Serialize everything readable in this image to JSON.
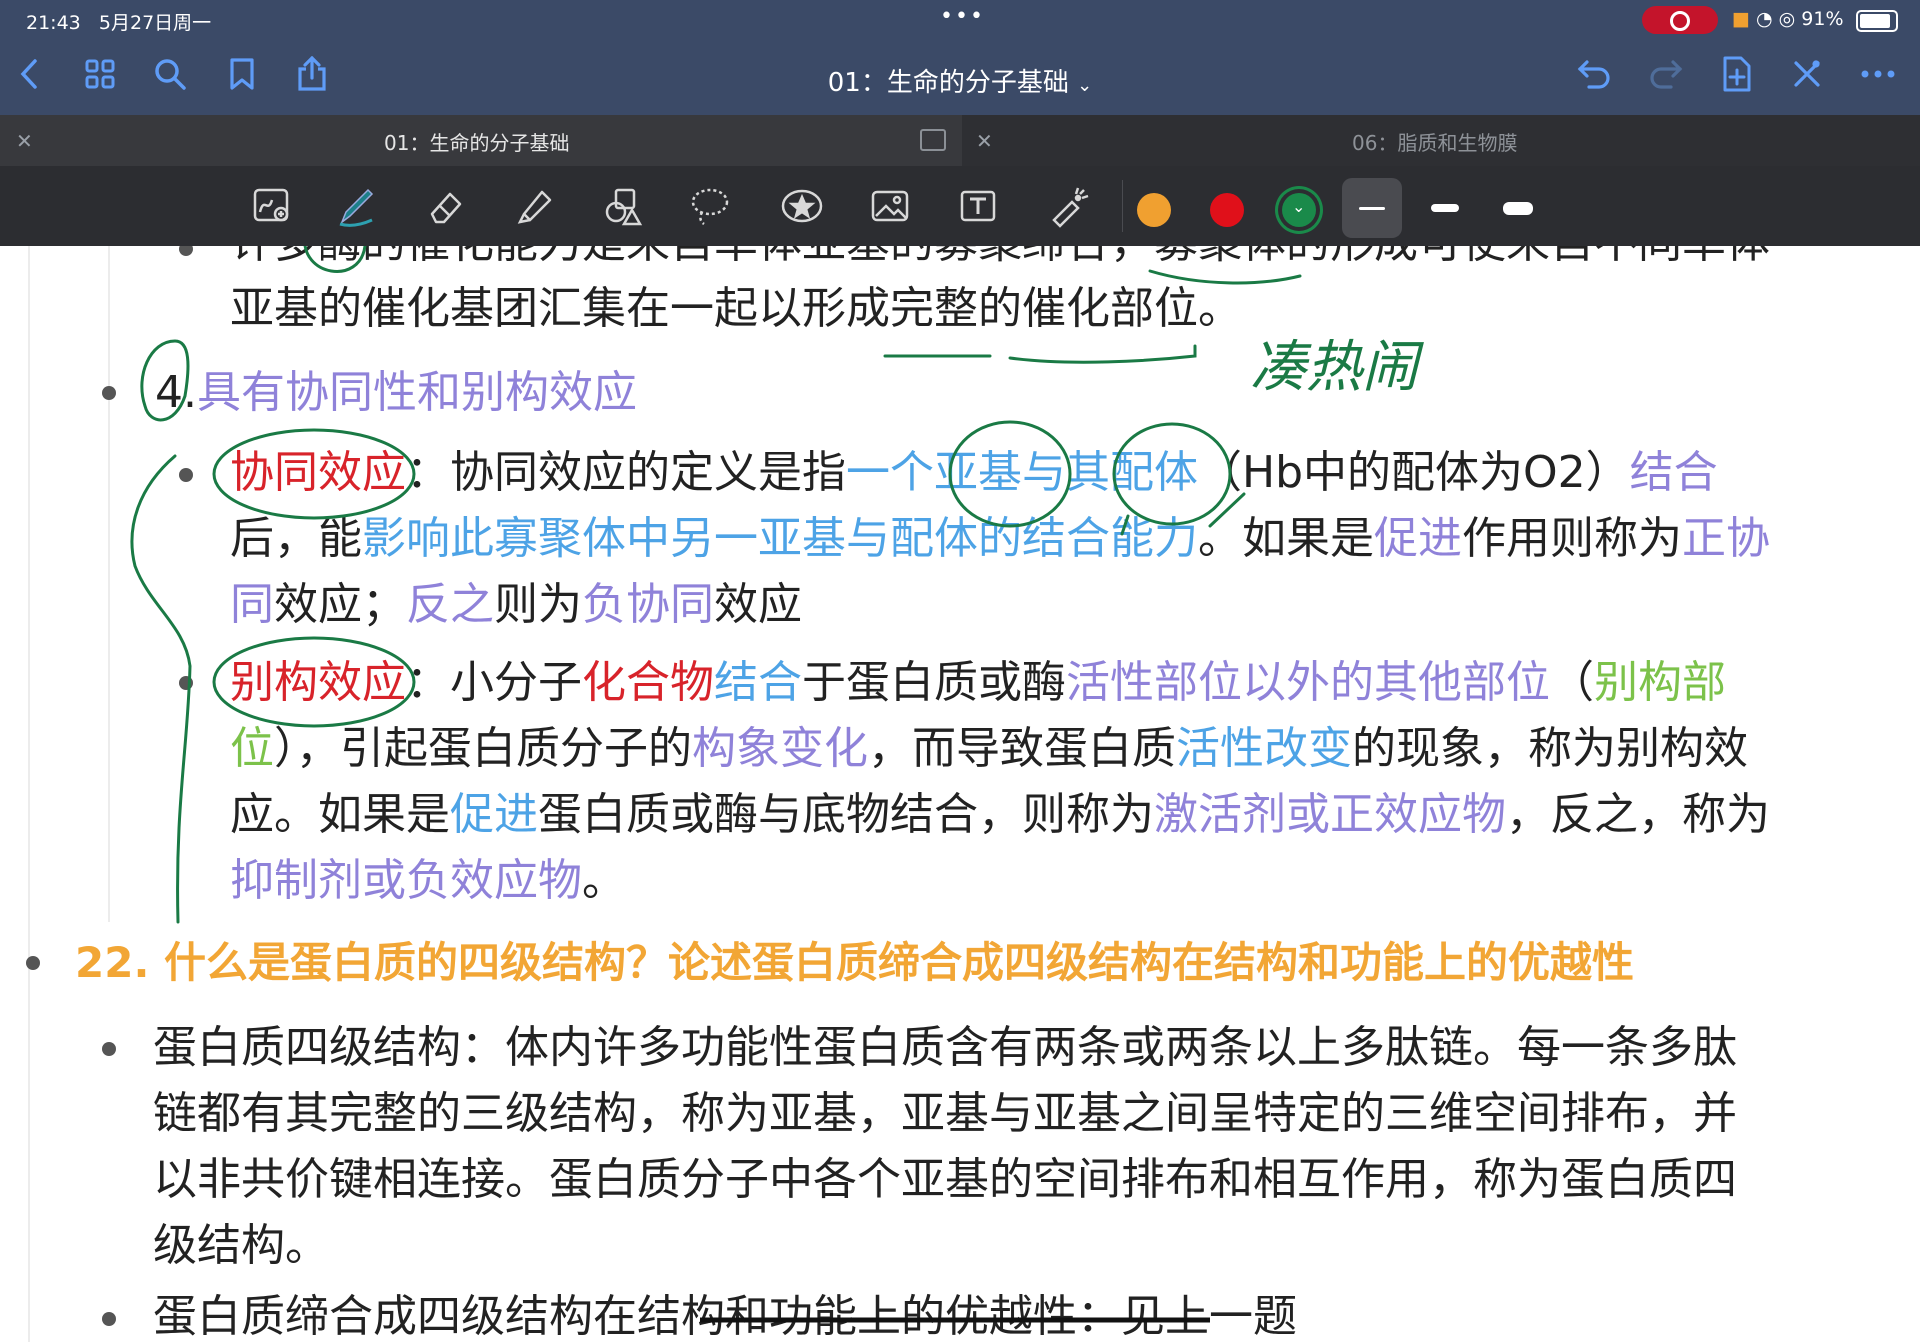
{
  "status_bar": {
    "time": "21:43",
    "date": "5月27日周一",
    "battery": "91%"
  },
  "nav": {
    "title": "01：生命的分子基础",
    "title_caret": "⌄"
  },
  "tabs": [
    {
      "label": "01：生命的分子基础"
    },
    {
      "label": "06：脂质和生物膜"
    }
  ],
  "toolbar": {
    "colors": [
      "#f0a030",
      "#e0101a",
      "#1a8a4a"
    ]
  },
  "content": {
    "line0_a": "许多酶的催化能力是来自单体亚基的募聚缔合，募聚体的形成可使来自不同单体",
    "line1": "亚基的催化基团汇集在一起以形成完整的催化部位。",
    "item4_num": "4.",
    "item4_text": "具有协同性和别构效应",
    "coop": {
      "term": "协同效应",
      "p1_a": "：协同效应的定义是指",
      "p1_b": "一个亚基与其配体",
      "p1_c": "（Hb中的配体为O2）",
      "p1_d": "结合",
      "p2_a": "后，能",
      "p2_b": "影响此寡聚体中另一亚基与配体的结合能力",
      "p2_c": "。如果是",
      "p2_d": "促进",
      "p2_e": "作用则称为",
      "p2_f": "正协",
      "p3_a": "同",
      "p3_b": "效应；",
      "p3_c": "反之",
      "p3_d": "则为",
      "p3_e": "负协同",
      "p3_f": "效应"
    },
    "allo": {
      "term": "别构效应",
      "p1_a": "：小分子",
      "p1_b": "化合物",
      "p1_c": "结合",
      "p1_d": "于蛋白质或酶",
      "p1_e": "活性部位以外的其他部位",
      "p1_f": "（",
      "p1_g": "别构部",
      "p2_a": "位",
      "p2_b": "），引起蛋白质分子的",
      "p2_c": "构象变化",
      "p2_d": "，而导致蛋白质",
      "p2_e": "活性改变",
      "p2_f": "的现象，称为别构效",
      "p3_a": "应。如果是",
      "p3_b": "促进",
      "p3_c": "蛋白质或酶与底物结合，则称为",
      "p3_d": "激活剂或正效应物",
      "p3_e": "，反之，称为",
      "p4_a": "抑制剂或负效应物",
      "p4_b": "。"
    },
    "q22": "22. 什么是蛋白质的四级结构？论述蛋白质缔合成四级结构在结构和功能上的优越性",
    "q22_a1": "蛋白质四级结构：体内许多功能性蛋白质含有两条或两条以上多肽链。每一条多肽",
    "q22_a2": "链都有其完整的三级结构，称为亚基，亚基与亚基之间呈特定的三维空间排布，并",
    "q22_a3": "以非共价键相连接。蛋白质分子中各个亚基的空间排布和相互作用，称为蛋白质四",
    "q22_a4": "级结构。",
    "q22_b": "蛋白质缔合成四级结构在结构和功能上的优越性：见上一题",
    "handwriting_note": "凑热闹"
  }
}
